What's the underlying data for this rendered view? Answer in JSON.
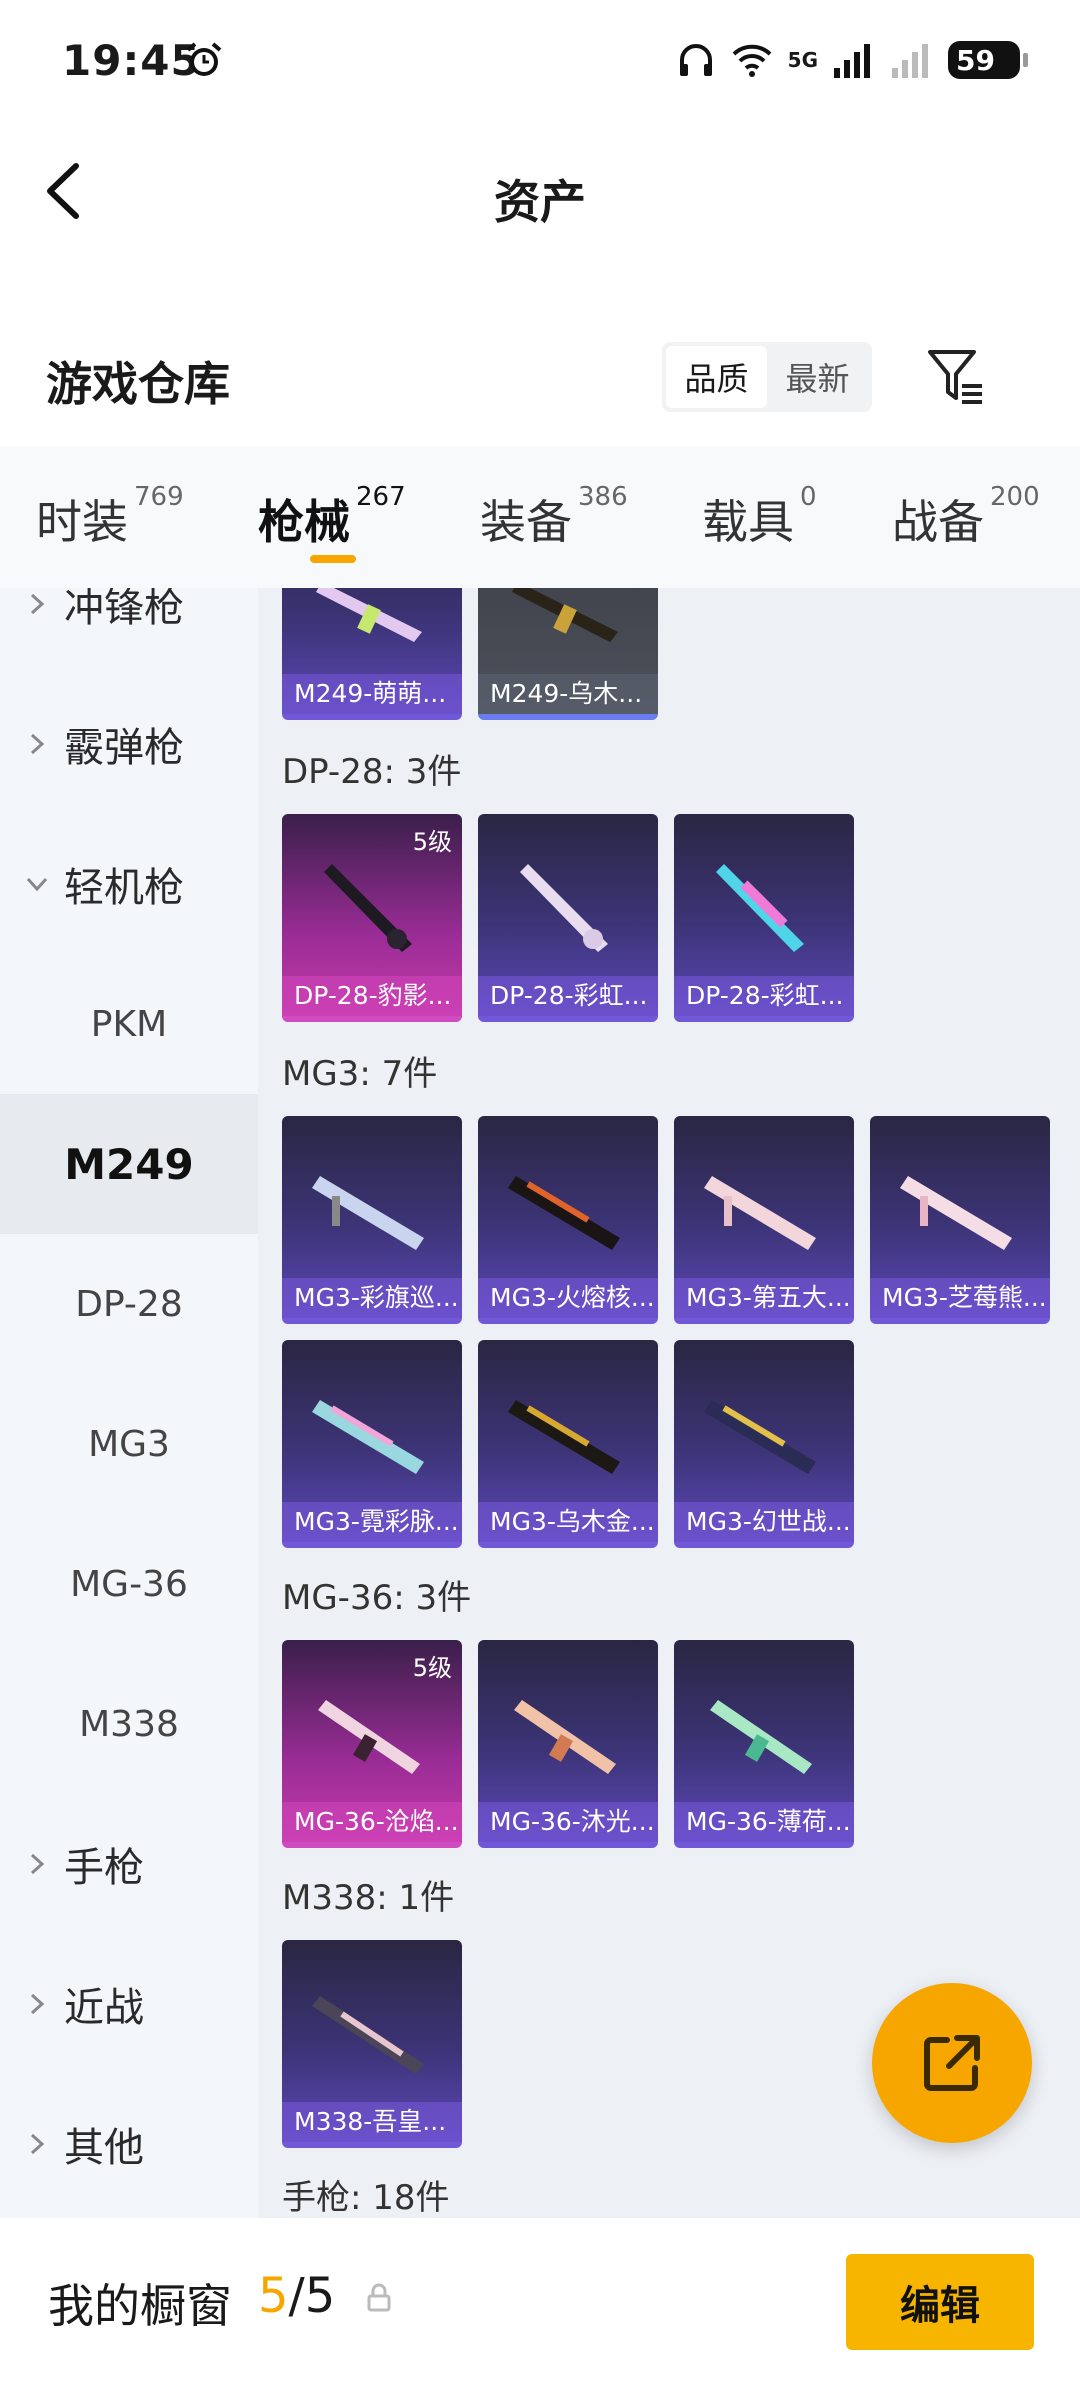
{
  "status_bar": {
    "time": "19:45",
    "battery": "59",
    "network": "5G"
  },
  "header": {
    "title": "资产"
  },
  "warehouse": {
    "title": "游戏仓库",
    "sort_options": [
      "品质",
      "最新"
    ],
    "sort_selected": "品质"
  },
  "tabs": [
    {
      "label": "时装",
      "count": "769"
    },
    {
      "label": "枪械",
      "count": "267",
      "active": true
    },
    {
      "label": "装备",
      "count": "386"
    },
    {
      "label": "载具",
      "count": "0"
    },
    {
      "label": "战备",
      "count": "200"
    }
  ],
  "sidebar": {
    "categories": [
      "冲锋枪",
      "霰弹枪",
      "轻机枪",
      "手枪",
      "近战",
      "其他"
    ],
    "subitems": [
      "PKM",
      "M249",
      "DP-28",
      "MG3",
      "MG-36",
      "M338"
    ],
    "active_subitem": "M249"
  },
  "groups": {
    "m249_cards": [
      "M249-萌萌...",
      "M249-乌木..."
    ],
    "dp28": {
      "label": "DP-28: 3件",
      "cards": [
        "DP-28-豹影...",
        "DP-28-彩虹...",
        "DP-28-彩虹..."
      ],
      "first_level": "5级"
    },
    "mg3": {
      "label": "MG3: 7件",
      "cards": [
        "MG3-彩旗巡...",
        "MG3-火熔核...",
        "MG3-第五大...",
        "MG3-芝莓熊...",
        "MG3-霓彩脉...",
        "MG3-乌木金...",
        "MG3-幻世战..."
      ]
    },
    "mg36": {
      "label": "MG-36: 3件",
      "cards": [
        "MG-36-沧焰...",
        "MG-36-沐光...",
        "MG-36-薄荷..."
      ],
      "first_level": "5级"
    },
    "m338": {
      "label": "M338: 1件",
      "cards": [
        "M338-吾皇..."
      ]
    },
    "pistol": {
      "label": "手枪: 18件"
    }
  },
  "bottom": {
    "showcase_label": "我的橱窗",
    "current": "5",
    "total": "/5",
    "edit_label": "编辑"
  },
  "colors": {
    "accent": "#f7a600",
    "card_purple": "#3d3478",
    "card_pink": "#9a2c96"
  }
}
